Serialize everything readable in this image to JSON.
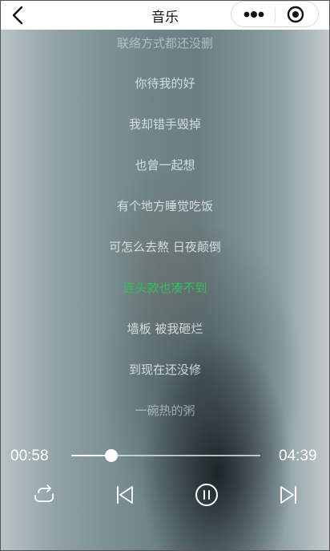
{
  "nav": {
    "title": "音乐",
    "back_icon": "chevron-left-icon",
    "more_icon": "more-dots-icon",
    "close_icon": "target-close-icon"
  },
  "lyrics": {
    "lines": [
      "联络方式都还没删",
      "你待我的好",
      "我却错手毁掉",
      "也曾一起想",
      "有个地方睡觉吃饭",
      "可怎么去熬 日夜颠倒",
      "连头款也凑不到",
      "墙板 被我砸烂",
      "到现在还没修",
      "一碗热的粥"
    ],
    "active_index": 6,
    "active_color": "#2fbf5e"
  },
  "player": {
    "current_time": "00:58",
    "total_time": "04:39",
    "progress": 0.21,
    "controls": [
      {
        "name": "repeat-icon"
      },
      {
        "name": "previous-track-icon"
      },
      {
        "name": "pause-icon"
      },
      {
        "name": "next-track-icon"
      }
    ]
  }
}
